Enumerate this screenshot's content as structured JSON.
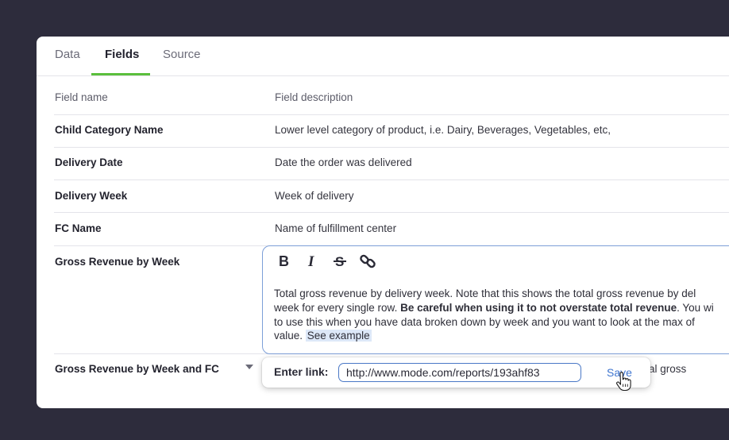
{
  "tabs": [
    {
      "label": "Data",
      "active": false
    },
    {
      "label": "Fields",
      "active": true
    },
    {
      "label": "Source",
      "active": false
    }
  ],
  "table": {
    "header": {
      "name": "Field name",
      "description": "Field description"
    },
    "rows": [
      {
        "name": "Child Category Name",
        "description": "Lower level category of product, i.e. Dairy, Beverages, Vegetables, etc,"
      },
      {
        "name": "Delivery Date",
        "description": "Date the order was delivered"
      },
      {
        "name": "Delivery Week",
        "description": "Week of delivery"
      },
      {
        "name": "FC Name",
        "description": "Name of fulfillment center"
      },
      {
        "name": "Gross Revenue by Week",
        "description": ""
      },
      {
        "name": "Gross Revenue by Week and FC",
        "description": "al gross"
      }
    ]
  },
  "editor": {
    "toolbar": [
      "B",
      "I",
      "S",
      "link"
    ],
    "line1": "Total gross revenue by delivery week. Note that this shows the total gross revenue by del",
    "line2_pre": "week for every single row. ",
    "line2_bold": "Be careful when using it to not overstate total revenue",
    "line2_post": ". You wi",
    "line3": "to use this when you have data broken down by week and you want to look at the max of",
    "line4_pre": "value. ",
    "link_text": "See example"
  },
  "link_popup": {
    "label": "Enter link:",
    "url": "http://www.mode.com/reports/193ahf83",
    "save_label": "Save"
  },
  "colors": {
    "background": "#2d2c3c",
    "accent_green": "#5bbf3c",
    "link_blue": "#3d74cf",
    "editor_border": "#7d9fd8"
  }
}
